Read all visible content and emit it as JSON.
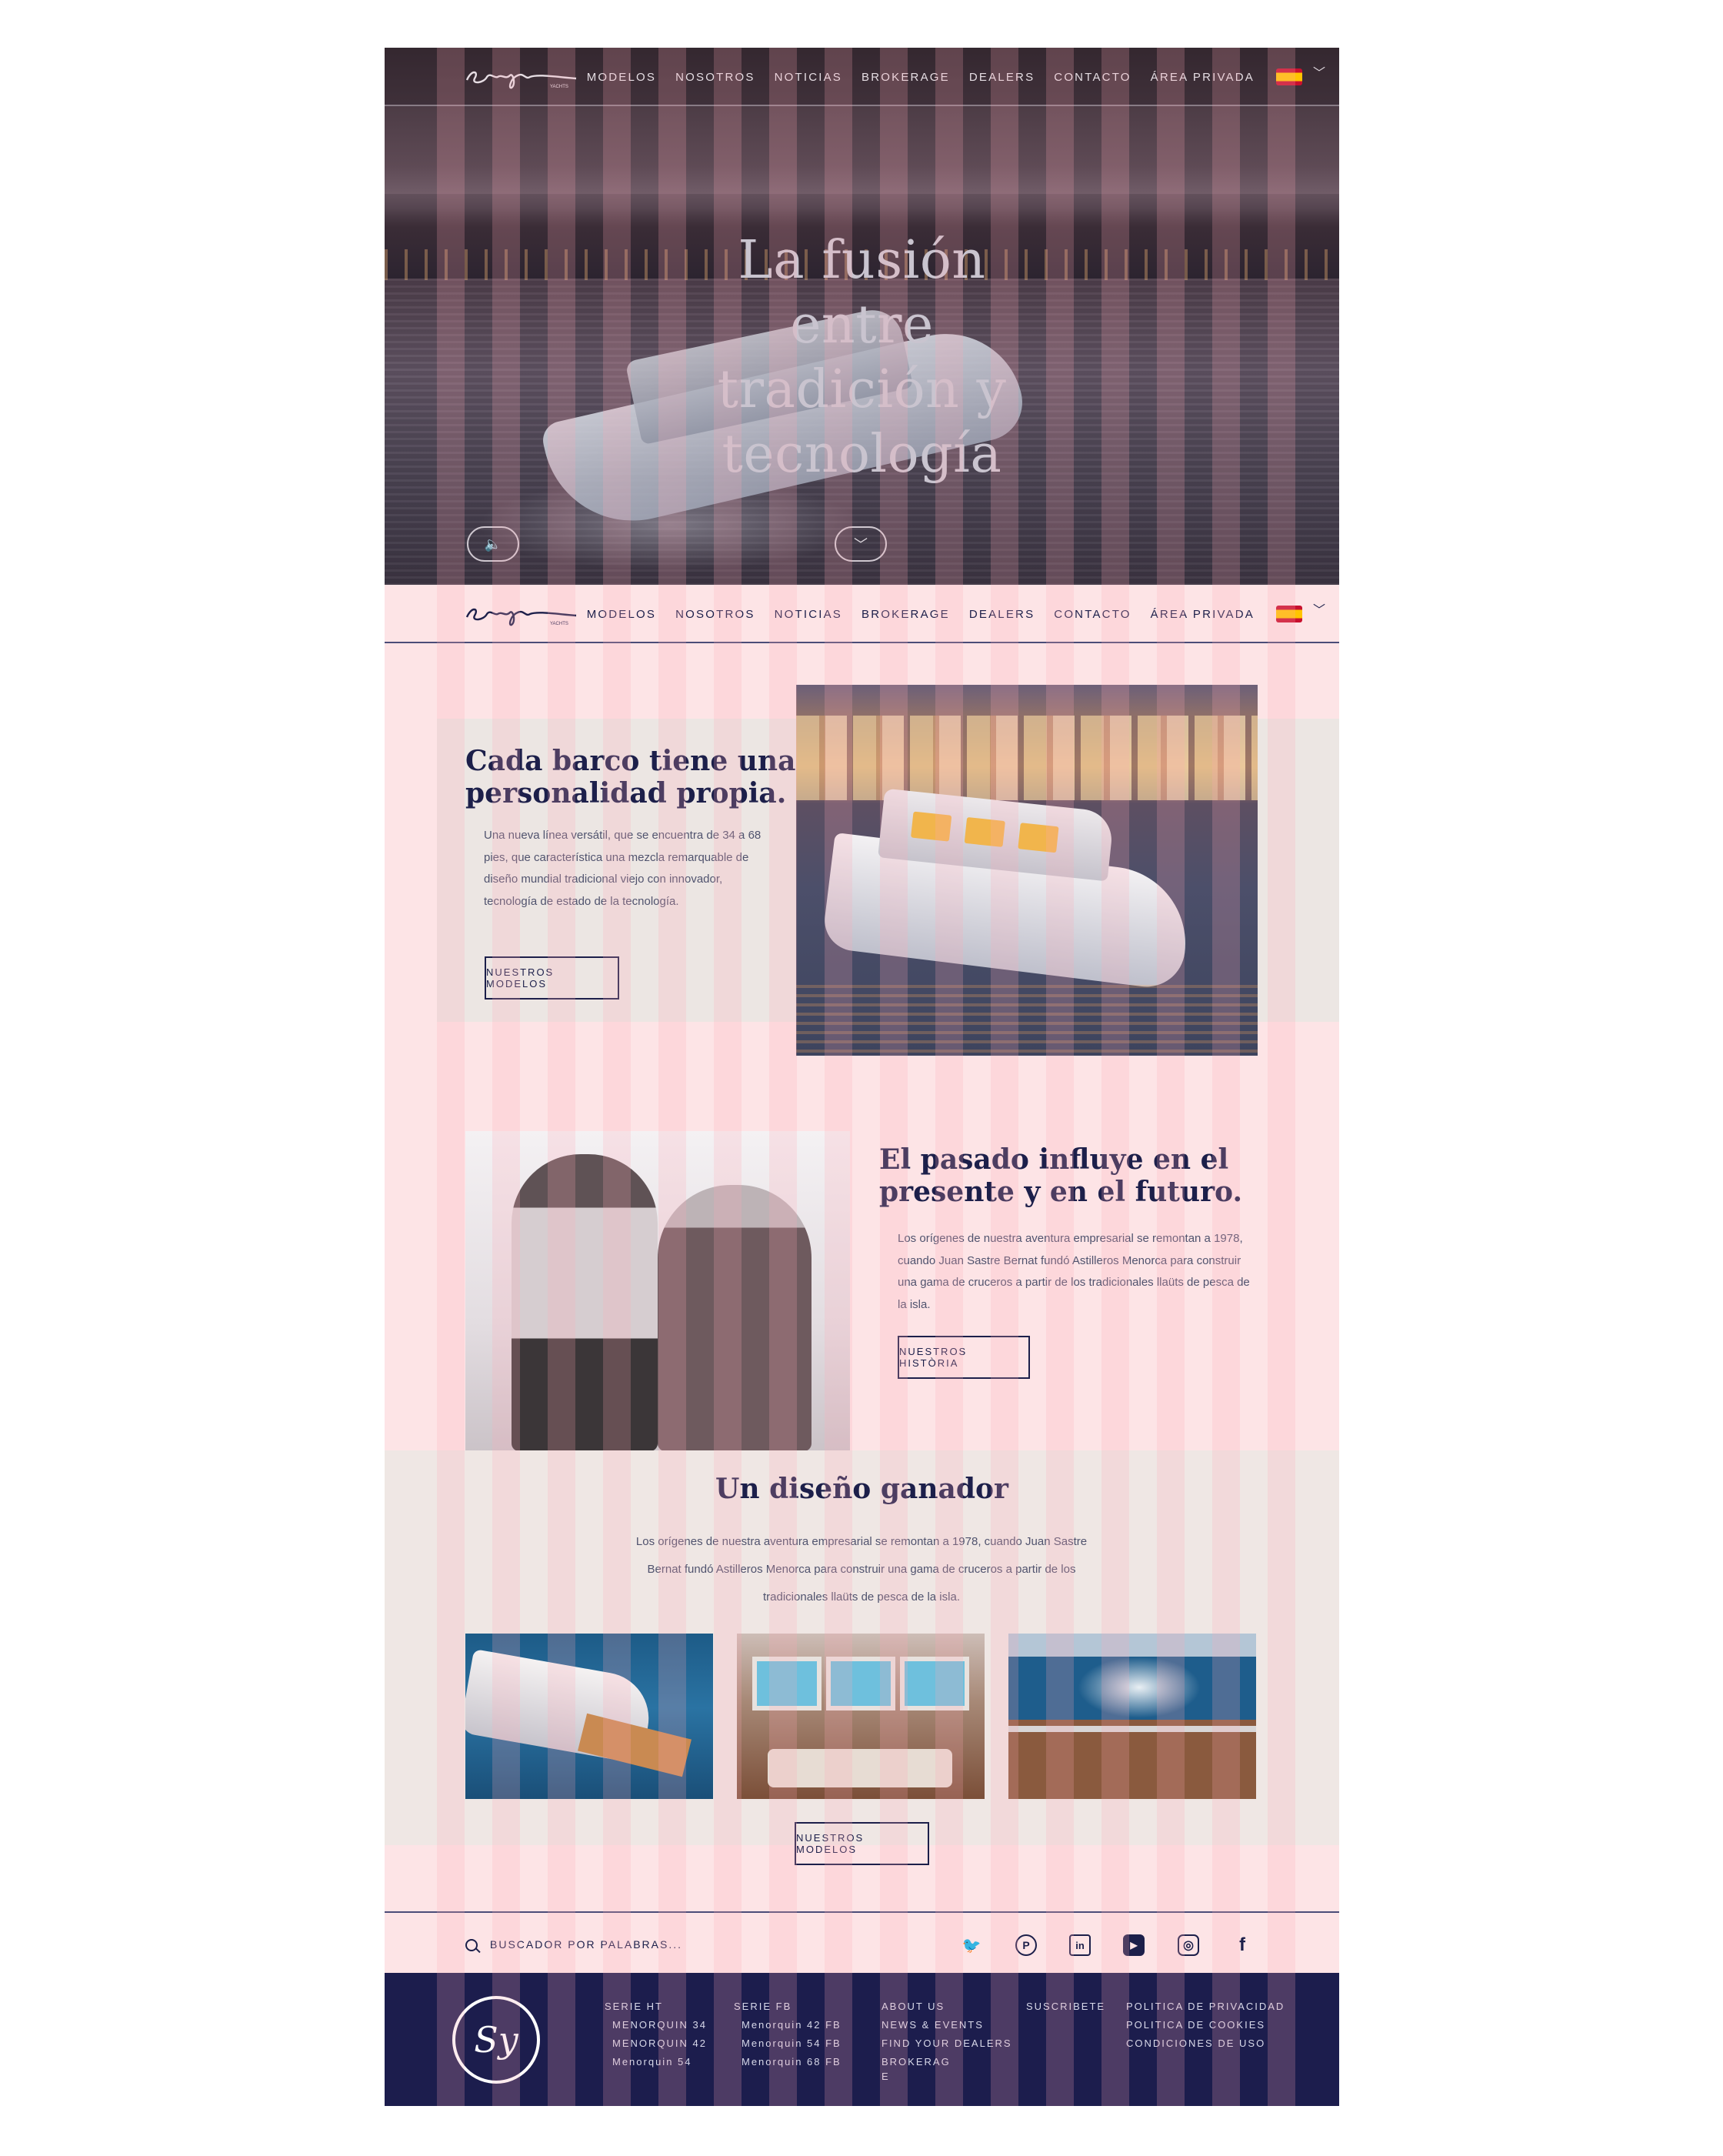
{
  "brand": {
    "logo_text": "Sasga",
    "logo_sub": "YACHTS",
    "footer_logo": "Sy"
  },
  "nav": {
    "items": [
      "MODELOS",
      "NOSOTROS",
      "NOTICIAS",
      "BROKERAGE",
      "DEALERS",
      "CONTACTO",
      "ÁREA PRIVADA"
    ],
    "language_flag": "es-flag-icon",
    "language_chevron": "﹀"
  },
  "hero": {
    "title": "La fusión entre tradición y tecnología",
    "sound_icon": "speaker-icon",
    "scroll_icon": "chevron-down-icon"
  },
  "section_personality": {
    "title": "Cada barco tiene  una personalidad propia.",
    "text": "Una nueva línea versátil, que se encuentra de 34 a 68 pies, que característica una mezcla remarquable de diseño mundial tradicional viejo con innovador, tecnología de estado de la tecnología.",
    "button": "NUESTROS MODELOS"
  },
  "section_history": {
    "title": "El pasado influye en el presente y en el futuro.",
    "text": "Los orígenes de nuestra aventura empresarial se remontan a 1978, cuando Juan Sastre Bernat fundó Astilleros Menorca para construir una gama de cruceros a partir de los tradicionales llaüts de pesca de la isla.",
    "button": "NUESTROS HISTÒRIA"
  },
  "section_design": {
    "title": "Un diseño ganador",
    "text": "Los orígenes de nuestra aventura empresarial se remontan a 1978, cuando Juan Sastre Bernat fundó Astilleros Menorca para construir una gama de cruceros a partir de los tradicionales llaüts de pesca de la isla.",
    "button": "NUESTROS MODELOS"
  },
  "search": {
    "placeholder": "BUSCADOR POR PALABRAS..."
  },
  "social": [
    {
      "name": "twitter-icon",
      "glyph": "🐦"
    },
    {
      "name": "pinterest-icon",
      "glyph": "P"
    },
    {
      "name": "linkedin-icon",
      "glyph": "in"
    },
    {
      "name": "youtube-icon",
      "glyph": "▶"
    },
    {
      "name": "instagram-icon",
      "glyph": "◎"
    },
    {
      "name": "facebook-icon",
      "glyph": "f"
    }
  ],
  "footer": {
    "serie_ht": {
      "title": "SERIE HT",
      "items": [
        "MENORQUIN 34",
        "MENORQUIN 42",
        "Menorquin 54"
      ]
    },
    "serie_fb": {
      "title": "SERIE FB",
      "items": [
        "Menorquin 42 FB",
        "Menorquin 54 FB",
        "Menorquin 68 FB"
      ]
    },
    "about": {
      "items": [
        "ABOUT US",
        "NEWS & EVENTS",
        "FIND YOUR DEALERS",
        "BROKERAG",
        "E"
      ]
    },
    "subscribe": "SUSCRIBETE",
    "legal": {
      "items": [
        "POLITICA DE PRIVACIDAD",
        "POLITICA DE COOKIES",
        "CONDICIONES DE USO"
      ]
    }
  },
  "colors": {
    "navy": "#1c1f4a",
    "footer_bg": "#1c1d4d",
    "page_pink": "#fde4e6",
    "band": "#ece6e3"
  }
}
